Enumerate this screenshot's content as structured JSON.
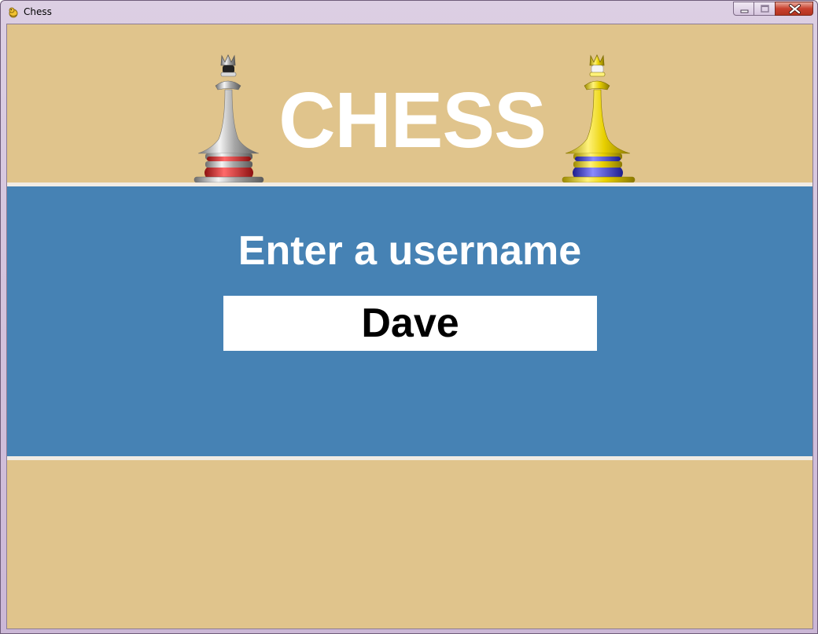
{
  "window": {
    "title": "Chess",
    "app_icon": "pygame-snake-icon",
    "controls": [
      "minimize-icon",
      "maximize-icon",
      "close-icon"
    ]
  },
  "header": {
    "title": "CHESS",
    "left_piece": "black-queen-icon",
    "right_piece": "white-queen-icon"
  },
  "login": {
    "prompt": "Enter a username",
    "username_value": "Dave"
  },
  "colors": {
    "background_tan": "#e0c48c",
    "panel_blue": "#4682b4",
    "divider": "#f1ece4",
    "text_white": "#ffffff",
    "input_bg": "#ffffff",
    "input_text": "#000000"
  }
}
